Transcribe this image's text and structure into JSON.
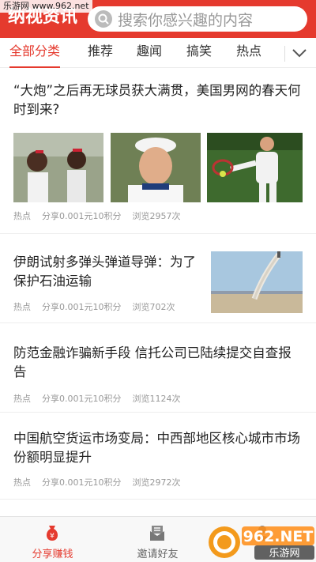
{
  "watermark_top": "乐游网 www.962.net",
  "header": {
    "logo": "纳视资讯",
    "search_placeholder": "搜索你感兴趣的内容",
    "bg_color": "#e53a2e"
  },
  "tabs": [
    {
      "label": "全部分类",
      "active": true
    },
    {
      "label": "推荐"
    },
    {
      "label": "趣闻"
    },
    {
      "label": "搞笑"
    },
    {
      "label": "热点"
    }
  ],
  "articles": [
    {
      "title": "“大炮”之后再无球员获大满贯，美国男网的春天何时到来?",
      "tag": "热点",
      "share": "分享0.001元10积分",
      "views": "浏览2957次",
      "images": [
        "tennis-sisters-photo",
        "tennis-player-portrait",
        "tennis-player-forehand"
      ]
    },
    {
      "title": "伊朗试射多弹头弹道导弹：为了保护石油运输",
      "tag": "热点",
      "share": "分享0.001元10积分",
      "views": "浏览702次",
      "images": [
        "missile-launch-photo"
      ]
    },
    {
      "title": "防范金融诈骗新手段 信托公司已陆续提交自查报告",
      "tag": "热点",
      "share": "分享0.001元10积分",
      "views": "浏览1124次"
    },
    {
      "title": "中国航空货运市场变局：中西部地区核心城市市场份额明显提升",
      "tag": "热点",
      "share": "分享0.001元10积分",
      "views": "浏览2972次"
    }
  ],
  "bottom_nav": [
    {
      "label": "分享赚钱",
      "icon": "money-bag-icon",
      "active": true
    },
    {
      "label": "邀请好友",
      "icon": "envelope-icon"
    },
    {
      "label": "",
      "icon": "user-icon"
    }
  ],
  "corner_watermark": {
    "brand": "962.NET",
    "sub": "乐游网"
  }
}
